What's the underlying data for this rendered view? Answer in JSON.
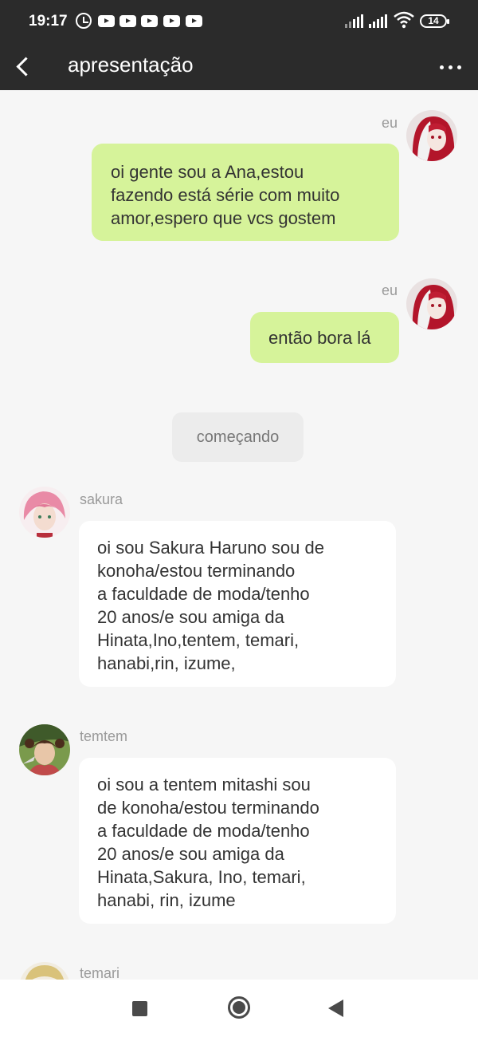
{
  "status_bar": {
    "time": "19:17",
    "battery": "14",
    "icons": [
      "alarm-icon",
      "youtube-icon",
      "youtube-icon",
      "youtube-icon",
      "youtube-icon",
      "youtube-icon",
      "signal-icon",
      "signal-icon",
      "wifi-icon",
      "battery-icon"
    ]
  },
  "header": {
    "title": "apresentação",
    "back_icon": "chevron-left-icon",
    "more_icon": "more-horizontal-icon",
    "background": "#2b2b2b"
  },
  "messages": [
    {
      "type": "me",
      "name": "eu",
      "text": "oi gente sou a Ana,estou\nfazendo está série com muito\namor,espero que vcs gostem"
    },
    {
      "type": "me",
      "name": "eu",
      "text": "então bora lá"
    },
    {
      "type": "system",
      "text": "começando"
    },
    {
      "type": "other",
      "name": "sakura",
      "text": "oi sou Sakura Haruno sou de\nkonoha/estou terminando\na faculdade de moda/tenho\n20 anos/e sou amiga da\nHinata,Ino,tentem, temari,\nhanabi,rin, izume,"
    },
    {
      "type": "other",
      "name": "temtem",
      "text": "oi sou a tentem mitashi sou\nde konoha/estou terminando\na faculdade de moda/tenho\n20 anos/e sou amiga da\nHinata,Sakura, Ino, temari,\nhanabi, rin, izume"
    },
    {
      "type": "other",
      "name": "temari",
      "text": ""
    }
  ],
  "colors": {
    "my_bubble": "#d6f39a",
    "other_bubble": "#ffffff",
    "chat_background": "#f6f6f6",
    "system_bubble": "#ececec"
  },
  "nav_bar": {
    "icons": [
      "recent-apps-icon",
      "home-icon",
      "back-icon"
    ]
  }
}
